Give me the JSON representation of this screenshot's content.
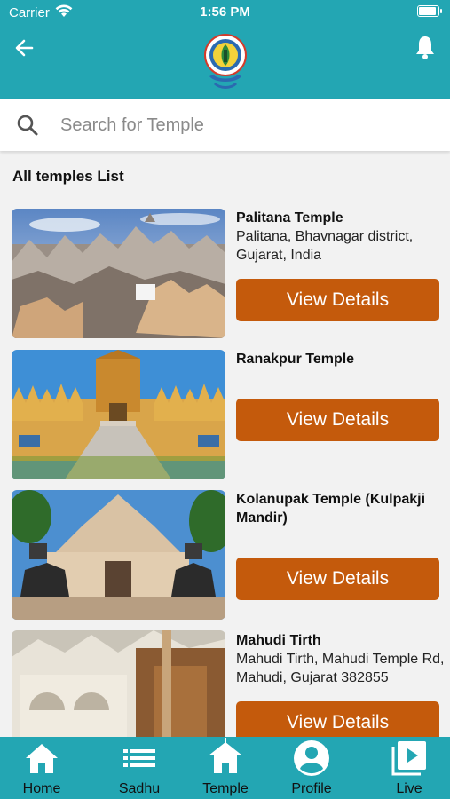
{
  "status_bar": {
    "carrier": "Carrier",
    "time": "1:56 PM"
  },
  "header": {
    "back_icon": "arrow-left-icon",
    "notification_icon": "bell-icon"
  },
  "search": {
    "placeholder": "Search for Temple",
    "value": ""
  },
  "section_title": "All temples List",
  "temples": [
    {
      "name": "Palitana Temple",
      "address": "Palitana, Bhavnagar district, Gujarat, India",
      "button": "View Details"
    },
    {
      "name": "Ranakpur Temple",
      "address": "",
      "button": "View Details"
    },
    {
      "name": "Kolanupak Temple (Kulpakji Mandir)",
      "address": "",
      "button": "View Details"
    },
    {
      "name": "Mahudi Tirth",
      "address": "Mahudi Tirth, Mahudi Temple Rd, Mahudi, Gujarat 382855",
      "button": "View Details"
    }
  ],
  "bottom_nav": [
    {
      "label": "Home",
      "icon": "home-icon"
    },
    {
      "label": "Sadhu",
      "icon": "list-icon"
    },
    {
      "label": "Temple",
      "icon": "temple-icon"
    },
    {
      "label": "Profile",
      "icon": "profile-icon"
    },
    {
      "label": "Live",
      "icon": "live-play-icon"
    }
  ],
  "colors": {
    "primary": "#23a6b3",
    "button": "#c45a0c",
    "background": "#f2f2f2"
  }
}
